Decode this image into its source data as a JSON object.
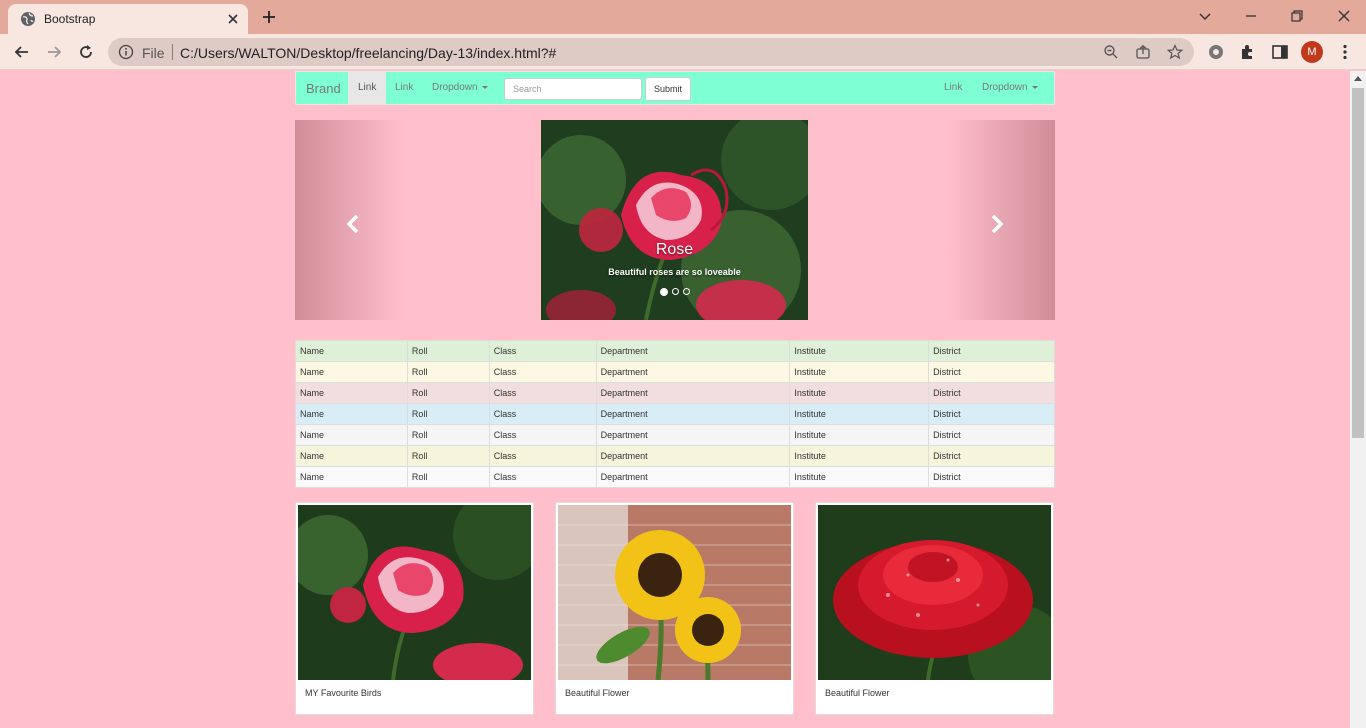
{
  "browser": {
    "tab_title": "Bootstrap",
    "url_scheme": "File",
    "url": "C:/Users/WALTON/Desktop/freelancing/Day-13/index.html?#",
    "profile_initial": "M"
  },
  "navbar": {
    "brand": "Brand",
    "left_links": [
      "Link",
      "Link"
    ],
    "left_dropdown": "Dropdown",
    "search_placeholder": "Search",
    "submit_label": "Submit",
    "right_link": "Link",
    "right_dropdown": "Dropdown",
    "background": "#7fffd4"
  },
  "carousel": {
    "caption_title": "Rose",
    "caption_text": "Beautiful roses are so loveable",
    "slide_count": 3,
    "active_index": 0
  },
  "table": {
    "rows": [
      {
        "bg": "#dff0d8",
        "cells": [
          "Name",
          "Roll",
          "Class",
          "Department",
          "Institute",
          "District"
        ]
      },
      {
        "bg": "#fcf8e3",
        "cells": [
          "Name",
          "Roll",
          "Class",
          "Department",
          "Institute",
          "District"
        ]
      },
      {
        "bg": "#f2dede",
        "cells": [
          "Name",
          "Roll",
          "Class",
          "Department",
          "Institute",
          "District"
        ]
      },
      {
        "bg": "#d9edf7",
        "cells": [
          "Name",
          "Roll",
          "Class",
          "Department",
          "Institute",
          "District"
        ]
      },
      {
        "bg": "#f5f5f5",
        "cells": [
          "Name",
          "Roll",
          "Class",
          "Department",
          "Institute",
          "District"
        ]
      },
      {
        "bg": "#f5f5dc",
        "cells": [
          "Name",
          "Roll",
          "Class",
          "Department",
          "Institute",
          "District"
        ]
      },
      {
        "bg": "#f9f9f9",
        "cells": [
          "Name",
          "Roll",
          "Class",
          "Department",
          "Institute",
          "District"
        ]
      }
    ]
  },
  "cards": [
    {
      "image": "rose-pink",
      "caption": "MY Favourite Birds"
    },
    {
      "image": "sunflower",
      "caption": "Beautiful Flower"
    },
    {
      "image": "rose-red",
      "caption": "Beautiful Flower"
    }
  ],
  "colors": {
    "page_bg": "#ffc0cb",
    "tabstrip_bg": "#e3a99a",
    "toolbar_bg": "#f8e6e1"
  }
}
